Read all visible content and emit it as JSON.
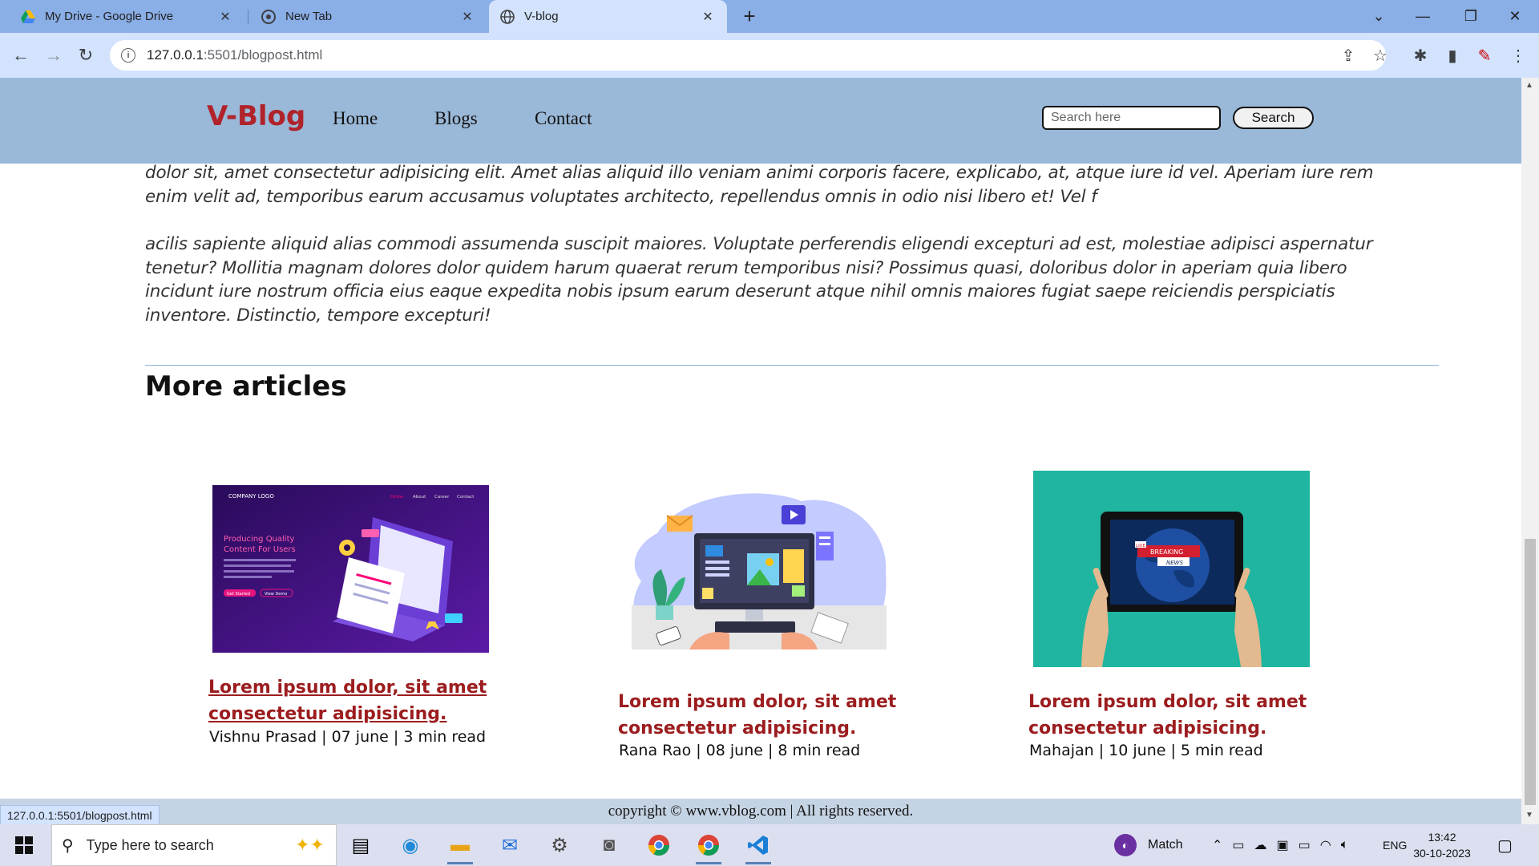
{
  "browser": {
    "tabs": [
      {
        "title": "My Drive - Google Drive",
        "icon": "google-drive-icon"
      },
      {
        "title": "New Tab",
        "icon": "chrome-icon"
      },
      {
        "title": "V-blog",
        "icon": "globe-icon"
      }
    ],
    "url_host": "127.0.0.1",
    "url_rest": ":5501/blogpost.html",
    "status_url": "127.0.0.1:5501/blogpost.html"
  },
  "header": {
    "logo": "V-Blog",
    "nav": [
      "Home",
      "Blogs",
      "Contact"
    ],
    "search_placeholder": "Search here",
    "search_button": "Search"
  },
  "article": {
    "paragraph1": "dolor sit, amet consectetur adipisicing elit. Amet alias aliquid illo veniam animi corporis facere, explicabo, at, atque iure id vel. Aperiam iure rem enim velit ad, temporibus earum accusamus voluptates architecto, repellendus omnis in odio nisi libero et! Vel f",
    "paragraph2": "acilis sapiente aliquid alias commodi assumenda suscipit maiores. Voluptate perferendis eligendi excepturi ad est, molestiae adipisci aspernatur tenetur? Mollitia magnam dolores dolor quidem harum quaerat rerum temporibus nisi? Possimus quasi, doloribus dolor in aperiam quia libero incidunt iure nostrum officia eius eaque expedita nobis ipsum earum deserunt atque nihil omnis maiores fugiat saepe reiciendis perspiciatis inventore. Distinctio, tempore excepturi!"
  },
  "more_articles": {
    "heading": "More articles",
    "cards": [
      {
        "title_line1": "Lorem ipsum dolor, sit amet",
        "title_line2": "consectetur adipisicing.",
        "meta": "Vishnu Prasad | 07 june | 3 min read"
      },
      {
        "title_line1": "Lorem ipsum dolor, sit amet",
        "title_line2": "consectetur adipisicing.",
        "meta": "Rana Rao | 08 june | 8 min read"
      },
      {
        "title_line1": "Lorem ipsum dolor, sit amet",
        "title_line2": "consectetur adipisicing.",
        "meta": "Mahajan | 10 june | 5 min read"
      }
    ],
    "card1_image": {
      "logo_text": "COMPANY LOGO",
      "menu": [
        "Home",
        "About",
        "Career",
        "Contact"
      ],
      "headline_line1": "Producing Quality",
      "headline_line2": "Content For Users",
      "btn1": "Get Started",
      "btn2": "View Demo"
    },
    "card3_image": {
      "live_badge": "LIVE",
      "breaking": "BREAKING",
      "news": "NEWS"
    }
  },
  "footer": {
    "text": "copyright © www.vblog.com | All rights reserved."
  },
  "taskbar": {
    "search_placeholder": "Type here to search",
    "weather_label": "Match",
    "language": "ENG",
    "time": "13:42",
    "date": "30-10-2023"
  },
  "colors": {
    "tabstrip": "#8aaee6",
    "toolbar": "#d3e3fd",
    "site_header": "#9ab8d8",
    "logo": "#b0232a",
    "card_title": "#9c1d1f",
    "footer": "#c5d4e4"
  }
}
